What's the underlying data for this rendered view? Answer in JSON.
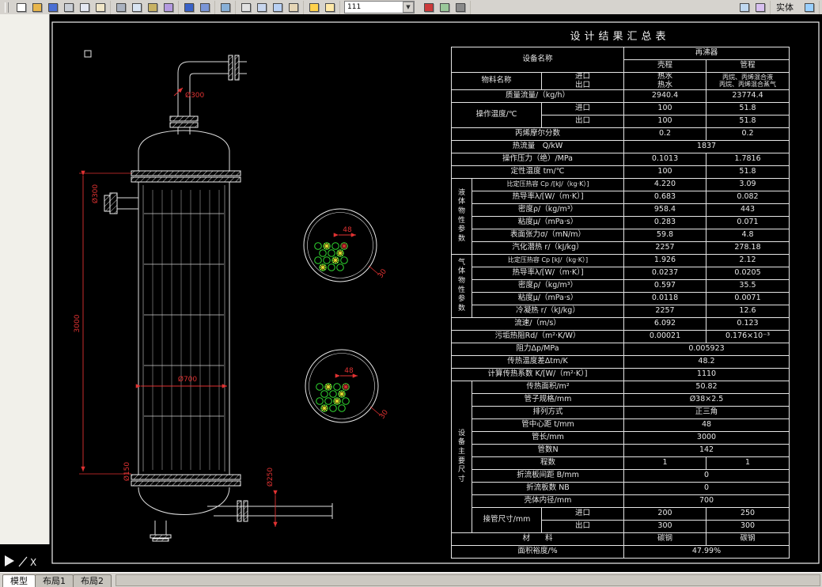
{
  "toolbar": {
    "layer_value": "111",
    "right_label": "实体",
    "items": [
      {
        "type": "group",
        "icons": [
          {
            "n": "new-file-icon",
            "c": "#ffffff"
          },
          {
            "n": "open-file-icon",
            "c": "#e8b64c"
          },
          {
            "n": "save-icon",
            "c": "#4a6fd4"
          },
          {
            "n": "print-icon",
            "c": "#c9ced6"
          },
          {
            "n": "print-preview-icon",
            "c": "#e4e8f2"
          },
          {
            "n": "spelling-icon",
            "c": "#f0e6c8"
          }
        ]
      },
      {
        "type": "group",
        "icons": [
          {
            "n": "cut-icon",
            "c": "#aab2c0"
          },
          {
            "n": "copy-icon",
            "c": "#d8e4f2"
          },
          {
            "n": "paste-icon",
            "c": "#c8b264"
          },
          {
            "n": "match-properties-icon",
            "c": "#b49ae0"
          }
        ]
      },
      {
        "type": "group",
        "icons": [
          {
            "n": "undo-icon",
            "c": "#3a62c8"
          },
          {
            "n": "redo-icon",
            "c": "#7a96d8"
          }
        ]
      },
      {
        "type": "group",
        "icons": [
          {
            "n": "insert-hyperlink-icon",
            "c": "#88b0d8"
          }
        ]
      },
      {
        "type": "group",
        "icons": [
          {
            "n": "pan-icon",
            "c": "#e2e2e2"
          },
          {
            "n": "zoom-realtime-icon",
            "c": "#c8d6ee"
          },
          {
            "n": "zoom-window-icon",
            "c": "#b8d0f4"
          },
          {
            "n": "zoom-previous-icon",
            "c": "#e6d6b6"
          }
        ]
      },
      {
        "type": "group",
        "icons": [
          {
            "n": "layers-icon",
            "c": "#ffd24c"
          },
          {
            "n": "layer-previous-icon",
            "c": "#ffe9a8"
          }
        ]
      },
      {
        "type": "combo"
      },
      {
        "type": "group",
        "icons": [
          {
            "n": "color-control-icon",
            "c": "#cc3a3a"
          },
          {
            "n": "linetype-icon",
            "c": "#9ac89a"
          },
          {
            "n": "lineweight-icon",
            "c": "#8a8a8a"
          }
        ]
      },
      {
        "type": "spacer"
      },
      {
        "type": "group",
        "icons": [
          {
            "n": "text-style-icon",
            "c": "#c0d8f0"
          },
          {
            "n": "dimension-style-icon",
            "c": "#d8c0f0"
          }
        ]
      },
      {
        "type": "label"
      },
      {
        "type": "group",
        "icons": [
          {
            "n": "properties-icon",
            "c": "#9ad0ff"
          }
        ]
      }
    ]
  },
  "drawing": {
    "dims": {
      "top_nozzle": "Ø300",
      "side_nozzle": "Ø300",
      "tube_length": "3000",
      "shell_diameter": "Ø700",
      "drain_nozzle": "Ø150",
      "bottom_nozzle": "Ø250",
      "tube_pitch": "48",
      "pitch_angle": "30"
    },
    "ucs_label": "X"
  },
  "table": {
    "title": "设计结果汇总表",
    "rows": [
      [
        {
          "t": "设备名称",
          "cs": 3,
          "rs": 2
        },
        {
          "t": "再沸器",
          "cs": 2
        }
      ],
      [
        {
          "t": "壳程"
        },
        {
          "t": "管程"
        }
      ],
      [
        {
          "t": "物料名称",
          "cs": 2
        },
        {
          "t": "进口\n出口",
          "cls": "ml"
        },
        {
          "t": "热水\n热水",
          "cls": "ml"
        },
        {
          "t": "丙烷、丙烯混合液\n丙烷、丙烯混合蒸气",
          "cls": "ml sm"
        }
      ],
      [
        {
          "t": "质量流量/（kg/h）",
          "cs": 3
        },
        {
          "t": "2940.4"
        },
        {
          "t": "23774.4"
        }
      ],
      [
        {
          "t": "操作温度/℃",
          "cs": 2,
          "rs": 2
        },
        {
          "t": "进口"
        },
        {
          "t": "100"
        },
        {
          "t": "51.8"
        }
      ],
      [
        {
          "t": "出口"
        },
        {
          "t": "100"
        },
        {
          "t": "51.8"
        }
      ],
      [
        {
          "t": "丙烯摩尔分数",
          "cs": 3
        },
        {
          "t": "0.2"
        },
        {
          "t": "0.2"
        }
      ],
      [
        {
          "t": "热流量　Q/kW",
          "cs": 3
        },
        {
          "t": "1837",
          "cs": 2
        }
      ],
      [
        {
          "t": "操作压力（绝）/MPa",
          "cs": 3
        },
        {
          "t": "0.1013"
        },
        {
          "t": "1.7816"
        }
      ],
      [
        {
          "t": "定性温度 tm/℃",
          "cs": 3
        },
        {
          "t": "100"
        },
        {
          "t": "51.8"
        }
      ],
      [
        {
          "t": "液\n体\n物\n性\n参\n数",
          "rs": 6,
          "cls": "vg"
        },
        {
          "t": "比定压热容 Cp /[kJ/（kg·K）]",
          "cs": 2,
          "cls": "sm"
        },
        {
          "t": "4.220"
        },
        {
          "t": "3.09"
        }
      ],
      [
        {
          "t": "热导率λ/[W/（m·K）]",
          "cs": 2
        },
        {
          "t": "0.683"
        },
        {
          "t": "0.082"
        }
      ],
      [
        {
          "t": "密度ρ/（kg/m³）",
          "cs": 2
        },
        {
          "t": "958.4"
        },
        {
          "t": "443"
        }
      ],
      [
        {
          "t": "粘度μ/（mPa·s）",
          "cs": 2
        },
        {
          "t": "0.283"
        },
        {
          "t": "0.071"
        }
      ],
      [
        {
          "t": "表面张力σ/（mN/m）",
          "cs": 2
        },
        {
          "t": "59.8"
        },
        {
          "t": "4.8"
        }
      ],
      [
        {
          "t": "汽化潜热 r/（kJ/kg）",
          "cs": 2
        },
        {
          "t": "2257"
        },
        {
          "t": "278.18"
        }
      ],
      [
        {
          "t": "气\n体\n物\n性\n参\n数",
          "rs": 5,
          "cls": "vg"
        },
        {
          "t": "比定压热容 Cp [kJ/（kg·K）]",
          "cs": 2,
          "cls": "sm"
        },
        {
          "t": "1.926"
        },
        {
          "t": "2.12"
        }
      ],
      [
        {
          "t": "热导率λ/[W/（m·K）]",
          "cs": 2
        },
        {
          "t": "0.0237"
        },
        {
          "t": "0.0205"
        }
      ],
      [
        {
          "t": "密度ρ/（kg/m³）",
          "cs": 2
        },
        {
          "t": "0.597"
        },
        {
          "t": "35.5"
        }
      ],
      [
        {
          "t": "粘度μ/（mPa·s）",
          "cs": 2
        },
        {
          "t": "0.0118"
        },
        {
          "t": "0.0071"
        }
      ],
      [
        {
          "t": "冷凝热 r/（kJ/kg）",
          "cs": 2
        },
        {
          "t": "2257"
        },
        {
          "t": "12.6"
        }
      ],
      [
        {
          "t": "流速/（m/s）",
          "cs": 3
        },
        {
          "t": "6.092"
        },
        {
          "t": "0.123"
        }
      ],
      [
        {
          "t": "污垢热阻Rd/（m²·K/W）",
          "cs": 3
        },
        {
          "t": "0.00021"
        },
        {
          "t": "0.176×10⁻³"
        }
      ],
      [
        {
          "t": "阻力Δp/MPa",
          "cs": 3
        },
        {
          "t": "0.005923",
          "cs": 2
        }
      ],
      [
        {
          "t": "传热温度差Δtm/K",
          "cs": 3
        },
        {
          "t": "48.2",
          "cs": 2
        }
      ],
      [
        {
          "t": "计算传热系数 K/[W/（m²·K）]",
          "cs": 3
        },
        {
          "t": "1110",
          "cs": 2
        }
      ],
      [
        {
          "t": "设\n备\n主\n要\n尺\n寸",
          "rs": 12,
          "cls": "vg"
        },
        {
          "t": "传热面积/m²",
          "cs": 2
        },
        {
          "t": "50.82",
          "cs": 2
        }
      ],
      [
        {
          "t": "管子规格/mm",
          "cs": 2
        },
        {
          "t": "Ø38×2.5",
          "cs": 2
        }
      ],
      [
        {
          "t": "排列方式",
          "cs": 2
        },
        {
          "t": "正三角",
          "cs": 2
        }
      ],
      [
        {
          "t": "管中心距 t/mm",
          "cs": 2
        },
        {
          "t": "48",
          "cs": 2
        }
      ],
      [
        {
          "t": "管长/mm",
          "cs": 2
        },
        {
          "t": "3000",
          "cs": 2
        }
      ],
      [
        {
          "t": "管数N",
          "cs": 2
        },
        {
          "t": "142",
          "cs": 2
        }
      ],
      [
        {
          "t": "程数",
          "cs": 2
        },
        {
          "t": "1"
        },
        {
          "t": "1"
        }
      ],
      [
        {
          "t": "折流板间距 B/mm",
          "cs": 2
        },
        {
          "t": "0",
          "cs": 2
        }
      ],
      [
        {
          "t": "折流板数 NB",
          "cs": 2
        },
        {
          "t": "0",
          "cs": 2
        }
      ],
      [
        {
          "t": "壳体内径/mm",
          "cs": 2
        },
        {
          "t": "700",
          "cs": 2
        }
      ],
      [
        {
          "t": "接管尺寸/mm",
          "rs": 2
        },
        {
          "t": "进口"
        },
        {
          "t": "200"
        },
        {
          "t": "250"
        }
      ],
      [
        {
          "t": "出口"
        },
        {
          "t": "300"
        },
        {
          "t": "300"
        }
      ],
      [
        {
          "t": "材　　料",
          "cs": 3
        },
        {
          "t": "碳钢"
        },
        {
          "t": "碳钢"
        }
      ],
      [
        {
          "t": "面积裕度/%",
          "cs": 3
        },
        {
          "t": "47.99%",
          "cs": 2
        }
      ]
    ]
  },
  "tabs": [
    {
      "label": "模型",
      "name": "tab-model",
      "active": true
    },
    {
      "label": "布局1",
      "name": "tab-layout1",
      "active": false
    },
    {
      "label": "布局2",
      "name": "tab-layout2",
      "active": false
    }
  ]
}
